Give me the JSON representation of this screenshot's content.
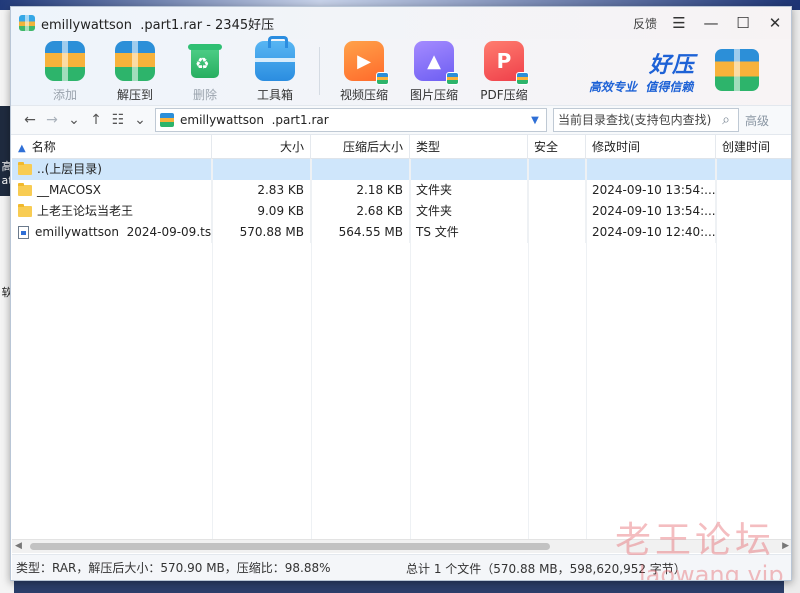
{
  "window": {
    "title": "emillywattson  .part1.rar - 2345好压",
    "feedback_label": "反馈",
    "menu_glyph": "☰",
    "minimize_glyph": "—",
    "maximize_glyph": "☐",
    "close_glyph": "✕"
  },
  "toolbar": {
    "items": [
      {
        "label": "添加",
        "icon": "add-archive-icon",
        "enabled": false
      },
      {
        "label": "解压到",
        "icon": "extract-archive-icon",
        "enabled": true
      },
      {
        "label": "删除",
        "icon": "recycle-bin-icon",
        "enabled": false
      },
      {
        "label": "工具箱",
        "icon": "toolbox-icon",
        "enabled": true
      },
      {
        "label": "视频压缩",
        "icon": "video-compress-icon",
        "enabled": true
      },
      {
        "label": "图片压缩",
        "icon": "image-compress-icon",
        "enabled": true
      },
      {
        "label": "PDF压缩",
        "icon": "pdf-compress-icon",
        "enabled": true
      }
    ]
  },
  "brand": {
    "name": "好压",
    "slogan": "高效专业  值得信赖"
  },
  "navbar": {
    "path": "emillywattson  .part1.rar",
    "search_placeholder": "当前目录查找(支持包内查找)",
    "advanced_label": "高级"
  },
  "table": {
    "columns": [
      "名称",
      "大小",
      "压缩后大小",
      "类型",
      "安全",
      "修改时间",
      "创建时间"
    ],
    "rows": [
      {
        "name": "..(上层目录)",
        "size": "",
        "packed": "",
        "type": "",
        "safe": "",
        "modified": "",
        "created": "",
        "kind": "folder",
        "selected": true
      },
      {
        "name": "__MACOSX",
        "size": "2.83 KB",
        "packed": "2.18 KB",
        "type": "文件夹",
        "safe": "",
        "modified": "2024-09-10 13:54:...",
        "created": "",
        "kind": "folder",
        "selected": false
      },
      {
        "name": "上老王论坛当老王",
        "size": "9.09 KB",
        "packed": "2.68 KB",
        "type": "文件夹",
        "safe": "",
        "modified": "2024-09-10 13:54:...",
        "created": "",
        "kind": "folder",
        "selected": false
      },
      {
        "name": "emillywattson  2024-09-09.ts...",
        "size": "570.88 MB",
        "packed": "564.55 MB",
        "type": "TS 文件",
        "safe": "",
        "modified": "2024-09-10 12:40:...",
        "created": "",
        "kind": "file",
        "selected": false
      }
    ]
  },
  "status": {
    "left": "类型：RAR，解压后大小：570.90 MB，压缩比：98.88%",
    "right": "总计 1 个文件（570.88 MB，598,620,952 字节）"
  },
  "watermark": {
    "text": "老王论坛",
    "sub": "laowang.vip"
  },
  "desktop": {
    "left_glyph_1": "高",
    "left_glyph_2": "at",
    "left_glyph_3": "软"
  },
  "colors": {
    "accent": "#1e62d6",
    "selection": "#cfe6fb",
    "watermark": "#e46268"
  }
}
